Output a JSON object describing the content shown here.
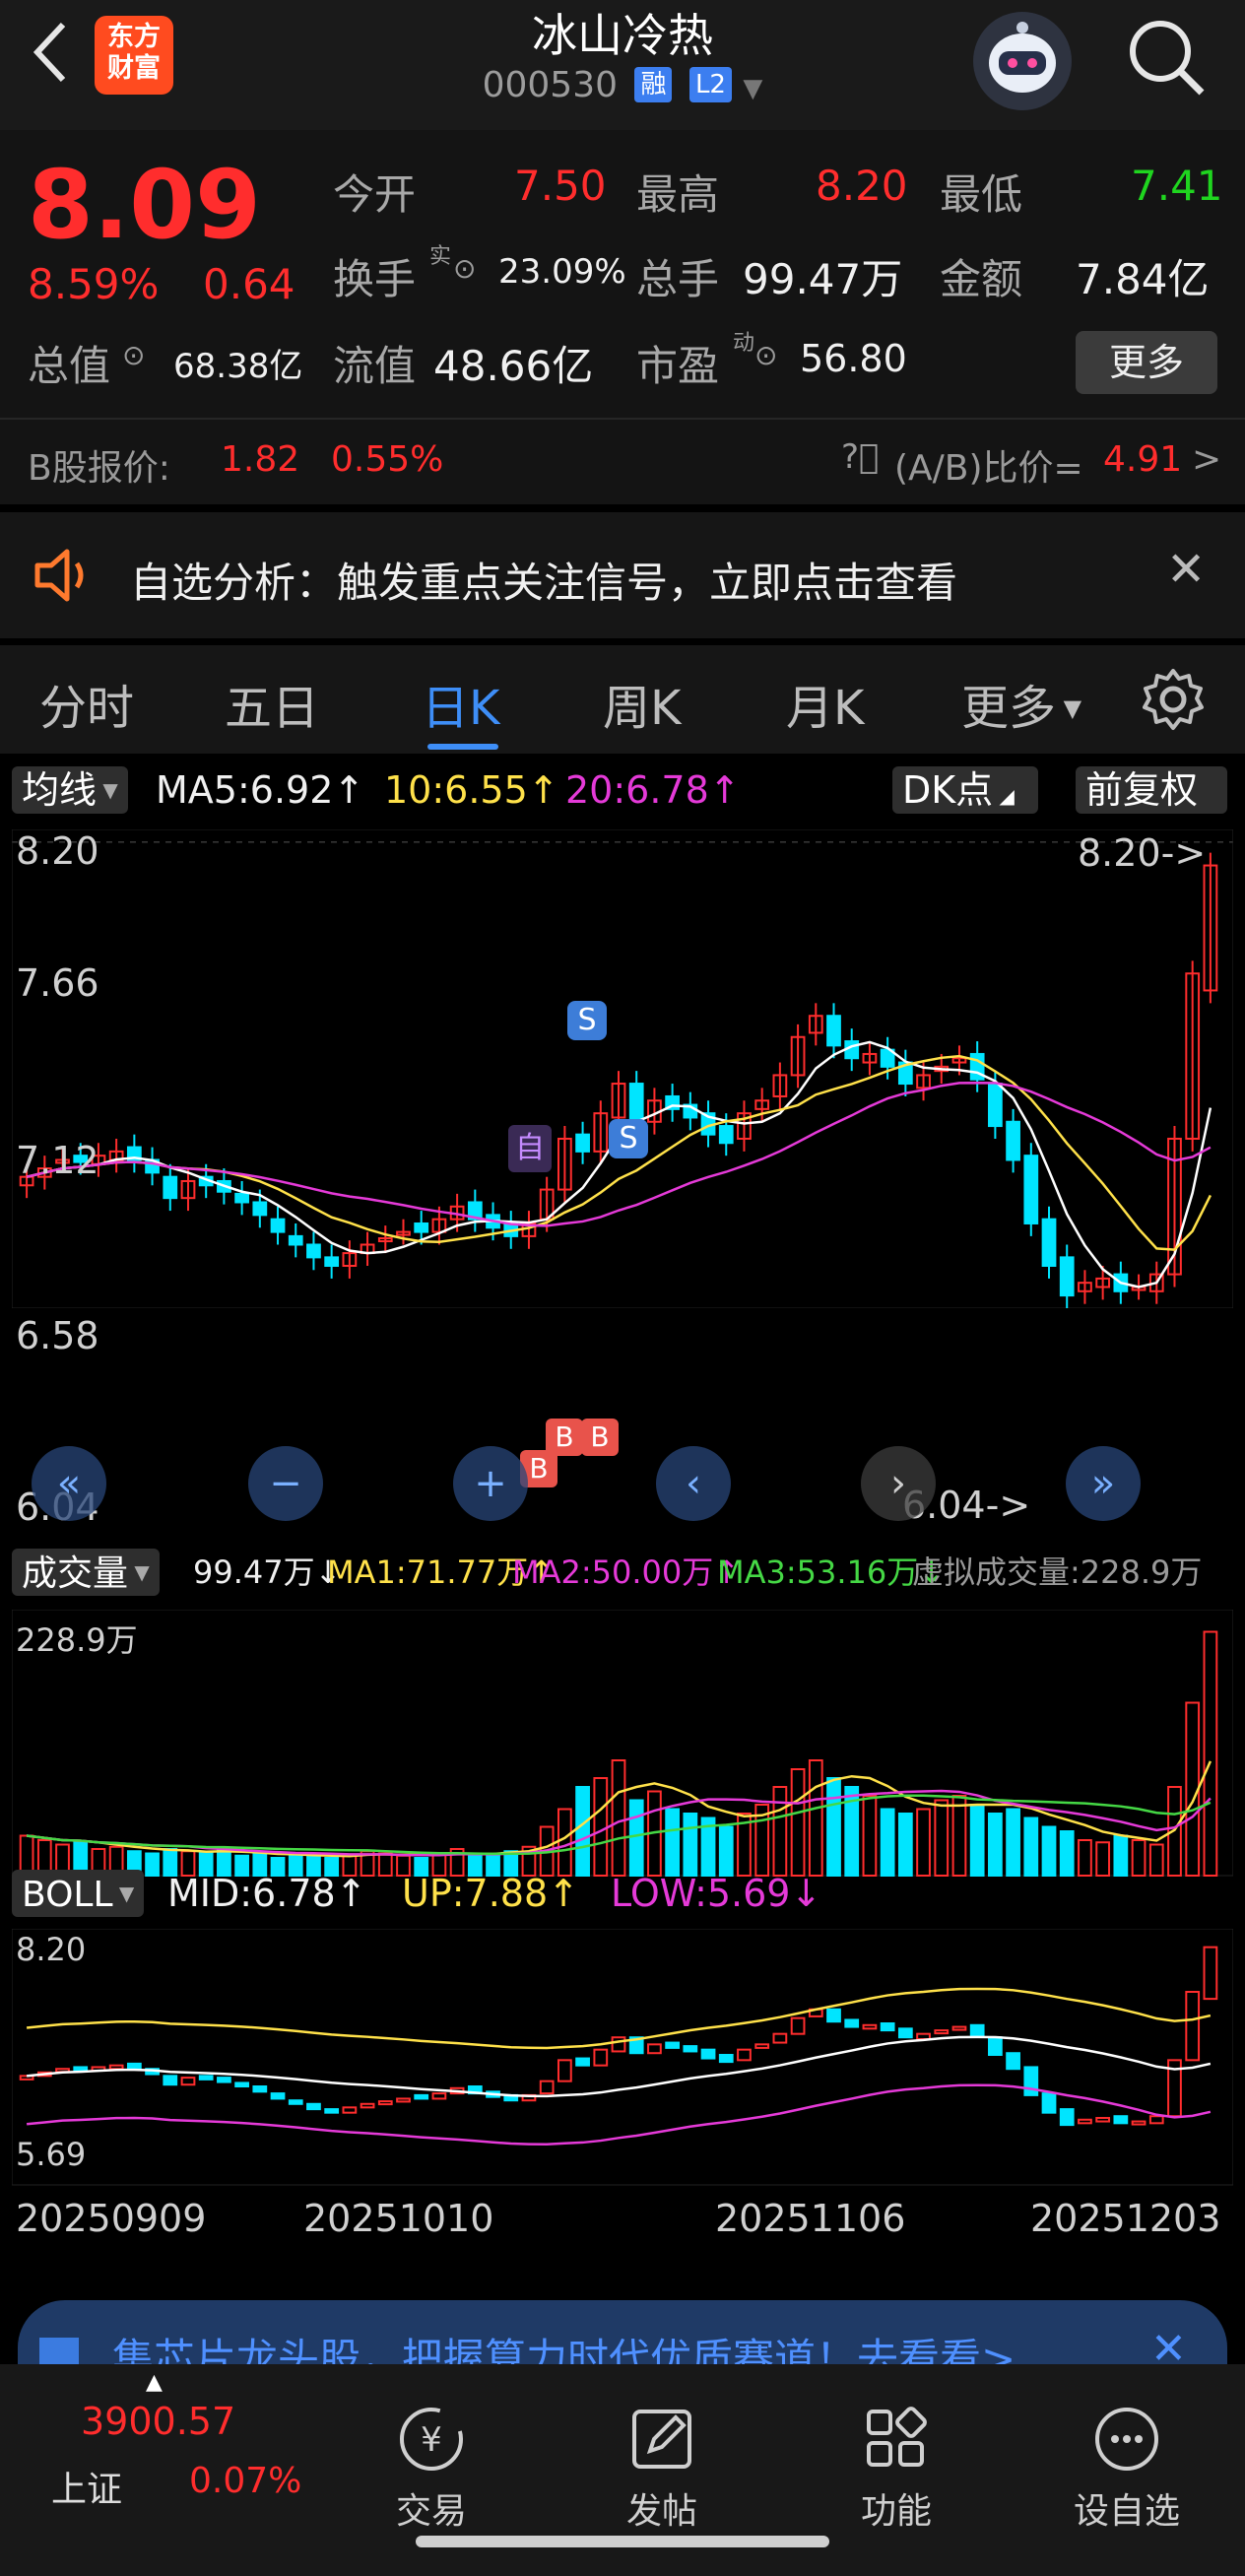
{
  "header": {
    "logo_text_line1": "东方",
    "logo_text_line2": "财富",
    "stock_name": "冰山冷热",
    "stock_code": "000530",
    "tag_margin": "融",
    "tag_level": "L2"
  },
  "quote": {
    "price": "8.09",
    "change_pct": "8.59%",
    "change_amt": "0.64",
    "market_cap_label": "总值",
    "market_cap": "68.38亿",
    "open_label": "今开",
    "open": "7.50",
    "high_label": "最高",
    "high": "8.20",
    "low_label": "最低",
    "low": "7.41",
    "turnover_label": "换手",
    "turnover_sup": "实",
    "turnover": "23.09%",
    "volume_label": "总手",
    "volume": "99.47万",
    "amount_label": "金额",
    "amount": "7.84亿",
    "float_cap_label": "流值",
    "float_cap": "48.66亿",
    "pe_label": "市盈",
    "pe_sup": "动",
    "pe": "56.80",
    "more_label": "更多",
    "b_share_label": "B股报价:",
    "b_share_price": "1.82",
    "b_share_pct": "0.55%",
    "ab_ratio_label": "(A/B)比价=",
    "ab_ratio": "4.91",
    "arrow": ">"
  },
  "notice": {
    "text": "自选分析：触发重点关注信号，立即点击查看"
  },
  "tabs": [
    "分时",
    "五日",
    "日K",
    "周K",
    "月K",
    "更多"
  ],
  "indicators": {
    "ma_select": "均线",
    "ma5": "MA5:6.92↑",
    "ma10": "10:6.55↑",
    "ma20": "20:6.78↑",
    "dk_label": "DK点",
    "adjust_label": "前复权",
    "vol_select": "成交量",
    "vol_now": "99.47万↓",
    "vol_ma1": "MA1:71.77万↑",
    "vol_ma2": "MA2:50.00万↑",
    "vol_ma3": "MA3:53.16万↓",
    "vol_virtual": "虚拟成交量:228.9万",
    "boll_select": "BOLL",
    "boll_mid": "MID:6.78↑",
    "boll_up": "UP:7.88↑",
    "boll_low": "LOW:5.69↓"
  },
  "kline_axis": {
    "y_ticks": [
      "8.20",
      "7.66",
      "7.12",
      "6.58",
      "6.04"
    ],
    "high_marker": "8.20->",
    "low_marker": "6.04->",
    "signal_self": "自",
    "signal_sell": "S",
    "signal_buy": "B"
  },
  "volume_axis": {
    "max_label": "228.9万"
  },
  "boll_axis": {
    "top": "8.20",
    "bottom": "5.69"
  },
  "x_dates": [
    "20250909",
    "20251010",
    "20251106",
    "20251203"
  ],
  "ad": {
    "text": "集芯片龙头股，把握算力时代优质赛道！去看看>"
  },
  "nav": {
    "index_name": "上证",
    "index_value": "3900.57",
    "index_pct": "0.07%",
    "items": [
      "交易",
      "发帖",
      "功能",
      "设自选"
    ]
  },
  "colors": {
    "up": "#ff2d2d",
    "down": "#00e5ff",
    "ma5": "#ffffff",
    "ma10": "#ffe14a",
    "ma20": "#e53ad8",
    "accent": "#3e8ef7"
  }
}
